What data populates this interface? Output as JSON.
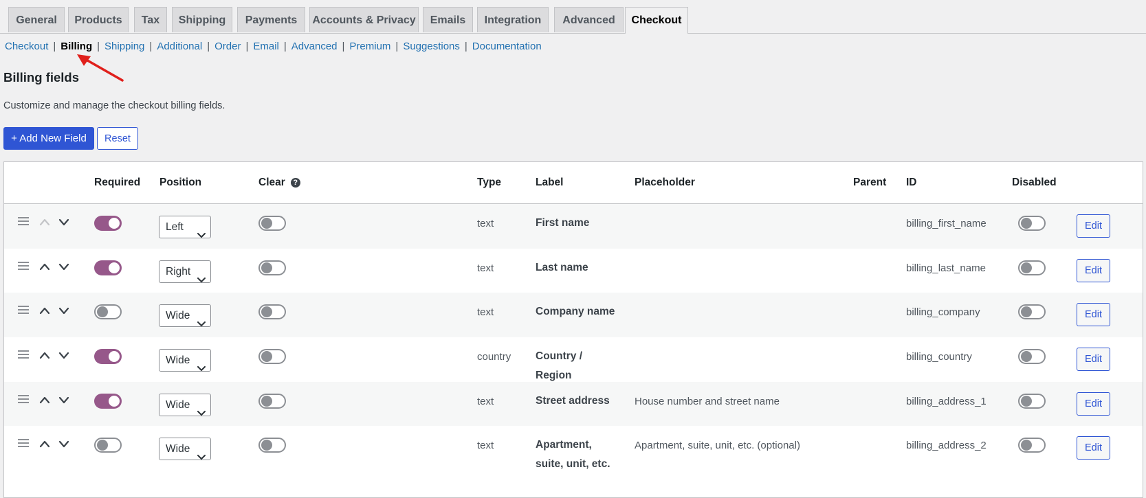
{
  "tabs": [
    "General",
    "Products",
    "Tax",
    "Shipping",
    "Payments",
    "Accounts & Privacy",
    "Emails",
    "Integration",
    "Advanced",
    "Checkout"
  ],
  "active_tab": "Checkout",
  "subnav": [
    "Checkout",
    "Billing",
    "Shipping",
    "Additional",
    "Order",
    "Email",
    "Advanced",
    "Premium",
    "Suggestions",
    "Documentation"
  ],
  "subnav_separator": "|",
  "current_section": "Billing",
  "page": {
    "title": "Billing fields",
    "description": "Customize and manage the checkout billing fields.",
    "add_button": "+ Add New Field",
    "reset_button": "Reset"
  },
  "table": {
    "headers": {
      "required": "Required",
      "position": "Position",
      "clear": "Clear",
      "type": "Type",
      "label": "Label",
      "placeholder": "Placeholder",
      "parent": "Parent",
      "id": "ID",
      "disabled": "Disabled"
    },
    "help_icon_glyph": "?",
    "edit_label": "Edit",
    "rows": [
      {
        "required": true,
        "position": "Left",
        "clear": false,
        "type": "text",
        "label": "First name",
        "placeholder": "",
        "parent": "",
        "id": "billing_first_name",
        "disabled": false
      },
      {
        "required": true,
        "position": "Right",
        "clear": false,
        "type": "text",
        "label": "Last name",
        "placeholder": "",
        "parent": "",
        "id": "billing_last_name",
        "disabled": false
      },
      {
        "required": false,
        "position": "Wide",
        "clear": false,
        "type": "text",
        "label": "Company name",
        "placeholder": "",
        "parent": "",
        "id": "billing_company",
        "disabled": false
      },
      {
        "required": true,
        "position": "Wide",
        "clear": false,
        "type": "country",
        "label": "Country / Region",
        "placeholder": "",
        "parent": "",
        "id": "billing_country",
        "disabled": false
      },
      {
        "required": true,
        "position": "Wide",
        "clear": false,
        "type": "text",
        "label": "Street address",
        "placeholder": "House number and street name",
        "parent": "",
        "id": "billing_address_1",
        "disabled": false
      },
      {
        "required": false,
        "position": "Wide",
        "clear": false,
        "type": "text",
        "label": "Apartment, suite, unit, etc.",
        "placeholder": "Apartment, suite, unit, etc. (optional)",
        "parent": "",
        "id": "billing_address_2",
        "disabled": false
      }
    ]
  },
  "colors": {
    "toggle_on": "#96588a",
    "primary": "#2f55d4",
    "link": "#2271b1",
    "annotation_arrow": "#e0201c"
  }
}
